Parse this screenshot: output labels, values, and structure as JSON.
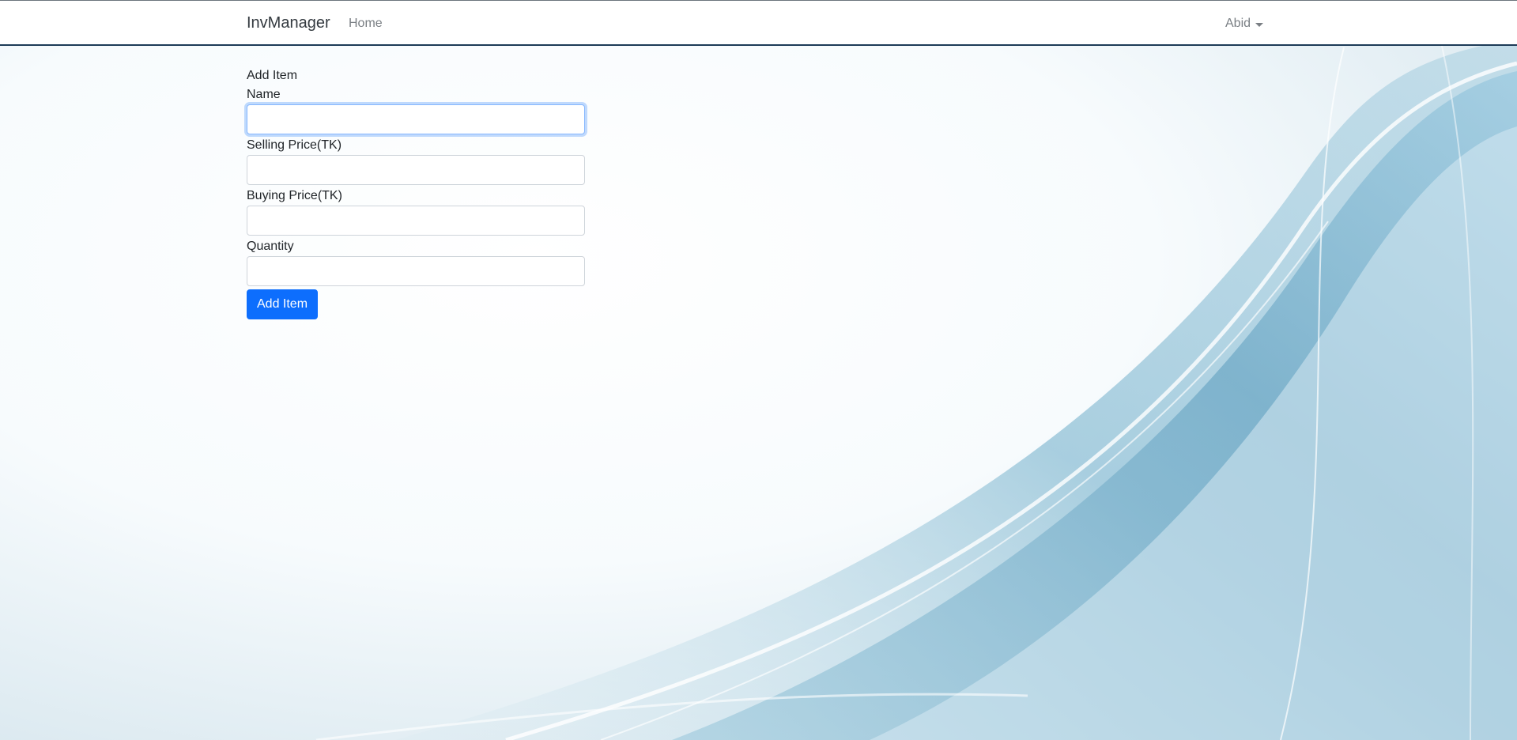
{
  "navbar": {
    "brand": "InvManager",
    "home_link": "Home",
    "user_name": "Abid"
  },
  "form": {
    "title": "Add Item",
    "fields": [
      {
        "label": "Name",
        "value": "",
        "placeholder": ""
      },
      {
        "label": "Selling Price(TK)",
        "value": "",
        "placeholder": ""
      },
      {
        "label": "Buying Price(TK)",
        "value": "",
        "placeholder": ""
      },
      {
        "label": "Quantity",
        "value": "",
        "placeholder": ""
      }
    ],
    "submit_label": "Add Item"
  },
  "colors": {
    "primary": "#0d6efd",
    "navbar_border": "#1d3b57",
    "background_accent": "#7fb6cf"
  }
}
